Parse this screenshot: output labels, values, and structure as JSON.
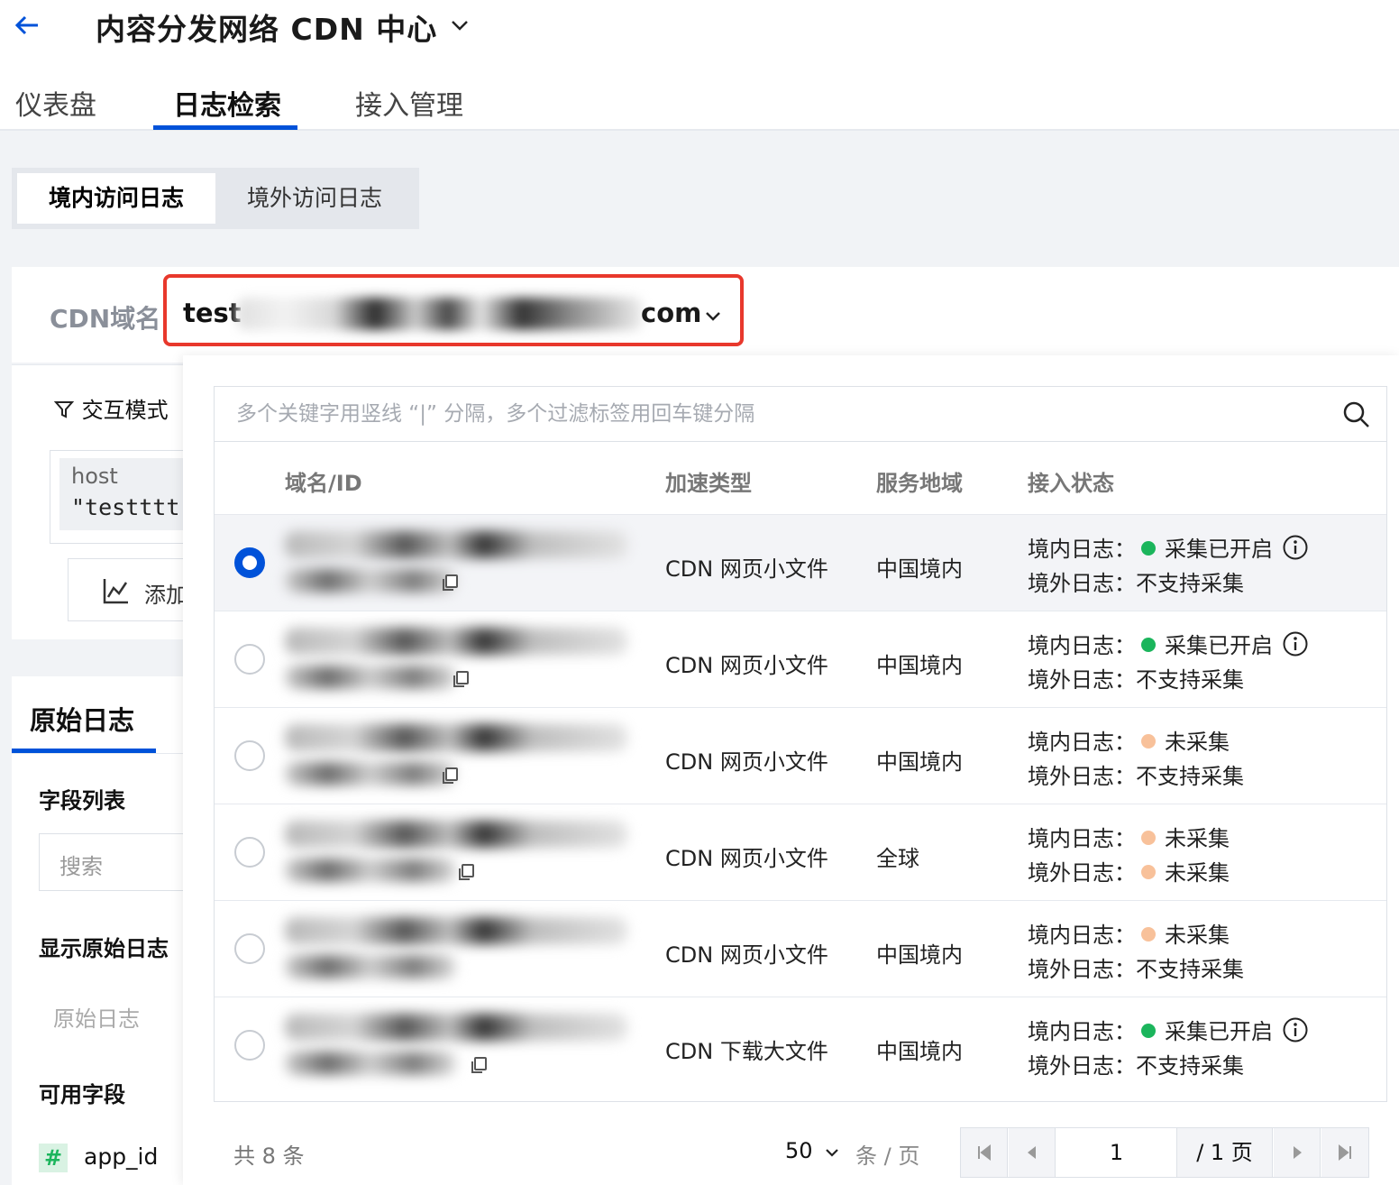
{
  "app": {
    "title": "内容分发网络 CDN 中心"
  },
  "nav": {
    "tabs": [
      "仪表盘",
      "日志检索",
      "接入管理"
    ]
  },
  "subtabs": [
    "境内访问日志",
    "境外访问日志"
  ],
  "domain": {
    "label": "CDN域名",
    "prefix": "test",
    "suffix": "com"
  },
  "left": {
    "interactive_mode": "交互模式",
    "filter_field": "host",
    "filter_value": "\"testttt",
    "add_label": "添加",
    "raw_tab": "原始日志",
    "field_list": "字段列表",
    "search_placeholder": "搜索",
    "show_raw": "显示原始日志",
    "raw_log_item": "原始日志",
    "available_fields": "可用字段",
    "field_hash": "#",
    "field_app_id": "app_id"
  },
  "dropdown": {
    "search_placeholder": "多个关键字用竖线 “|” 分隔，多个过滤标签用回车键分隔",
    "headers": [
      "域名/ID",
      "加速类型",
      "服务地域",
      "接入状态"
    ],
    "status_labels": {
      "domestic": "境内日志：",
      "overseas": "境外日志："
    },
    "rows": [
      {
        "selected": true,
        "type": "CDN 网页小文件",
        "region": "中国境内",
        "domestic": "采集已开启",
        "domestic_color": "#1bb55c",
        "domestic_info": true,
        "overseas": "不支持采集",
        "overseas_color": ""
      },
      {
        "selected": false,
        "type": "CDN 网页小文件",
        "region": "中国境内",
        "domestic": "采集已开启",
        "domestic_color": "#1bb55c",
        "domestic_info": true,
        "overseas": "不支持采集",
        "overseas_color": ""
      },
      {
        "selected": false,
        "type": "CDN 网页小文件",
        "region": "中国境内",
        "domestic": "未采集",
        "domestic_color": "#f8c19a",
        "domestic_info": false,
        "overseas": "不支持采集",
        "overseas_color": ""
      },
      {
        "selected": false,
        "type": "CDN 网页小文件",
        "region": "全球",
        "domestic": "未采集",
        "domestic_color": "#f8c19a",
        "domestic_info": false,
        "overseas": "未采集",
        "overseas_color": "#f8c19a"
      },
      {
        "selected": false,
        "type": "CDN 网页小文件",
        "region": "中国境内",
        "domestic": "未采集",
        "domestic_color": "#f8c19a",
        "domestic_info": false,
        "overseas": "不支持采集",
        "overseas_color": ""
      },
      {
        "selected": false,
        "type": "CDN 下载大文件",
        "region": "中国境内",
        "domestic": "采集已开启",
        "domestic_color": "#1bb55c",
        "domestic_info": true,
        "overseas": "不支持采集",
        "overseas_color": ""
      }
    ],
    "footer": {
      "total": "共 8 条",
      "page_size": "50",
      "per_page": "条 / 页",
      "current_page": "1",
      "total_pages": "/ 1 页"
    }
  }
}
